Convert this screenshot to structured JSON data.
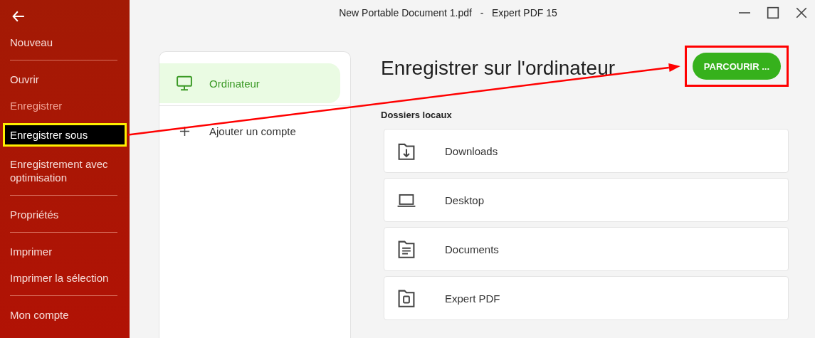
{
  "window": {
    "title": "New Portable Document 1.pdf   -   Expert PDF 15",
    "controls": [
      {
        "kind": "minimize"
      },
      {
        "kind": "maximize"
      },
      {
        "kind": "close"
      }
    ]
  },
  "sidebar": {
    "back": {
      "kind": "back"
    },
    "items": [
      {
        "label": "Nouveau",
        "disabled": false,
        "selected": false,
        "separator_after": true
      },
      {
        "label": "Ouvrir",
        "disabled": false,
        "selected": false,
        "separator_after": false
      },
      {
        "label": "Enregistrer",
        "disabled": true,
        "selected": false,
        "separator_after": false
      },
      {
        "label": "Enregistrer sous",
        "disabled": false,
        "selected": true,
        "separator_after": false
      },
      {
        "label": "Enregistrement avec optimisation",
        "disabled": false,
        "selected": false,
        "separator_after": true
      },
      {
        "label": "Propriétés",
        "disabled": false,
        "selected": false,
        "separator_after": true
      },
      {
        "label": "Imprimer",
        "disabled": false,
        "selected": false,
        "separator_after": false
      },
      {
        "label": "Imprimer la sélection",
        "disabled": false,
        "selected": false,
        "separator_after": true
      },
      {
        "label": "Mon compte",
        "disabled": false,
        "selected": false,
        "separator_after": false
      }
    ]
  },
  "locations": [
    {
      "label": "Ordinateur",
      "kind": "computer",
      "selected": true
    },
    {
      "label": "Ajouter un compte",
      "kind": "add",
      "selected": false
    }
  ],
  "heading": "Enregistrer sur l'ordinateur",
  "browse_button": {
    "label": "PARCOURIR ...",
    "outlined": true
  },
  "section_label": "Dossiers locaux",
  "folders": [
    {
      "label": "Downloads",
      "kind": "downloads"
    },
    {
      "label": "Desktop",
      "kind": "desktop"
    },
    {
      "label": "Documents",
      "kind": "documents"
    },
    {
      "label": "Expert PDF",
      "kind": "app"
    }
  ],
  "annotations": [
    {
      "kind": "arrow"
    }
  ]
}
